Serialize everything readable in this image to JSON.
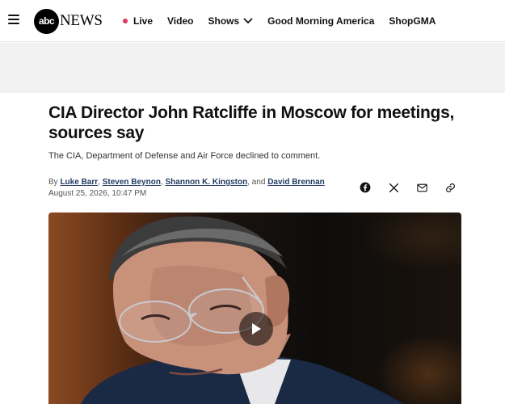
{
  "brand": {
    "logo_circle": "abc",
    "logo_word": "NEWS"
  },
  "nav": {
    "live": "Live",
    "video": "Video",
    "shows": "Shows",
    "gma": "Good Morning America",
    "shop": "ShopGMA"
  },
  "article": {
    "headline": "CIA Director John Ratcliffe in Moscow for meetings, sources say",
    "subhead": "The CIA, Department of Defense and Air Force declined to comment.",
    "byline_prefix": "By",
    "authors": [
      "Luke Barr",
      "Steven Beynon",
      "Shannon K. Kingston",
      "David Brennan"
    ],
    "byline_and": ", and",
    "timestamp": "August 25, 2026, 10:47 PM"
  },
  "share": {
    "icons": [
      "facebook-icon",
      "x-icon",
      "email-icon",
      "link-icon"
    ]
  },
  "colors": {
    "live_dot": "#e0395a",
    "author_link": "#1f3a5f",
    "ad_band": "#f2f2f2"
  }
}
